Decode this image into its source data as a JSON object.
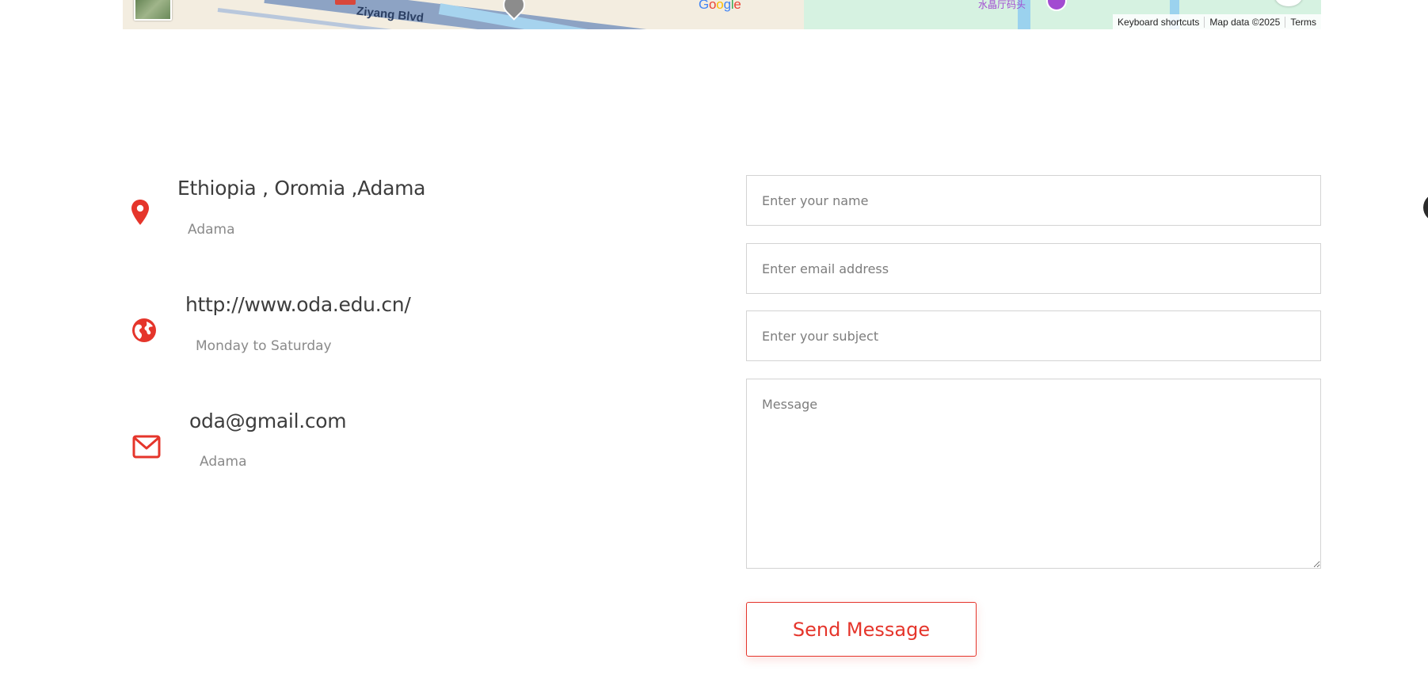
{
  "map": {
    "road_label": "Ziyang Blvd",
    "google_logo": [
      "G",
      "o",
      "o",
      "g",
      "l",
      "e"
    ],
    "google_colors": [
      "#4285F4",
      "#EA4335",
      "#FBBC05",
      "#4285F4",
      "#34A853",
      "#EA4335"
    ],
    "poi_label": "水晶厅码头",
    "attribution": {
      "shortcuts": "Keyboard shortcuts",
      "map_data": "Map data ©2025",
      "terms": "Terms"
    }
  },
  "contact": {
    "accent_color": "#e5352b",
    "items": [
      {
        "icon": "map-pin-icon",
        "title": "Ethiopia , Oromia ,Adama",
        "subtitle": "Adama"
      },
      {
        "icon": "globe-icon",
        "title": "http://www.oda.edu.cn/",
        "subtitle": "Monday to Saturday"
      },
      {
        "icon": "envelope-icon",
        "title": "oda@gmail.com",
        "subtitle": "Adama"
      }
    ]
  },
  "form": {
    "name_placeholder": "Enter your name",
    "email_placeholder": "Enter email address",
    "subject_placeholder": "Enter your subject",
    "message_placeholder": "Message",
    "submit_label": "Send Message"
  }
}
